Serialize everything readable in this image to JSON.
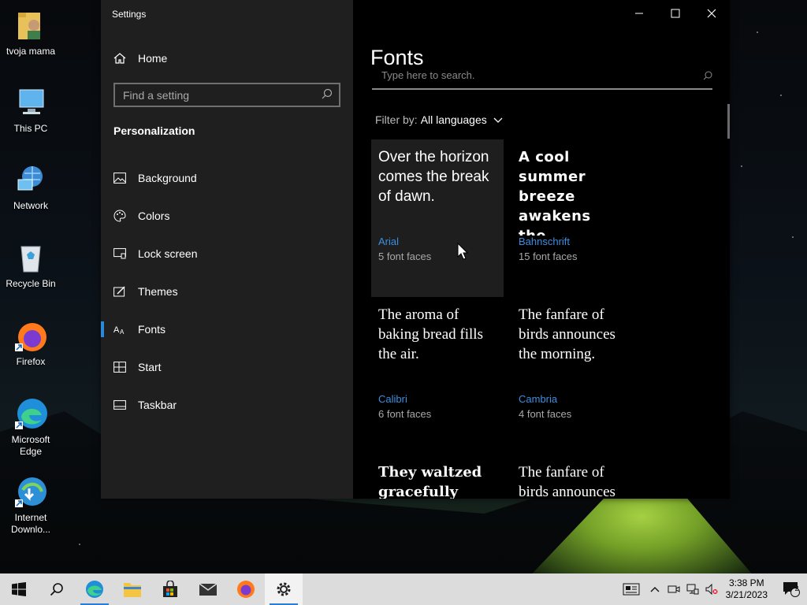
{
  "desktop": {
    "icons": [
      {
        "label": "tvoja mama",
        "icon": "user-folder-icon"
      },
      {
        "label": "This PC",
        "icon": "this-pc-icon"
      },
      {
        "label": "Network",
        "icon": "network-icon"
      },
      {
        "label": "Recycle Bin",
        "icon": "recycle-bin-icon"
      },
      {
        "label": "Firefox",
        "icon": "firefox-icon"
      },
      {
        "label": "Microsoft Edge",
        "icon": "edge-icon"
      },
      {
        "label": "Internet Downlo...",
        "icon": "idm-icon"
      }
    ]
  },
  "window": {
    "title": "Settings"
  },
  "sidebar": {
    "home_label": "Home",
    "search_placeholder": "Find a setting",
    "section_title": "Personalization",
    "items": [
      {
        "label": "Background",
        "icon": "picture-icon"
      },
      {
        "label": "Colors",
        "icon": "palette-icon"
      },
      {
        "label": "Lock screen",
        "icon": "lock-screen-icon"
      },
      {
        "label": "Themes",
        "icon": "themes-icon"
      },
      {
        "label": "Fonts",
        "icon": "fonts-icon",
        "active": true
      },
      {
        "label": "Start",
        "icon": "start-icon"
      },
      {
        "label": "Taskbar",
        "icon": "taskbar-icon"
      }
    ]
  },
  "content": {
    "page_title": "Fonts",
    "search_placeholder": "Type here to search.",
    "filter_label": "Filter by:",
    "filter_value": "All languages",
    "fonts": [
      {
        "sample": "Over the horizon comes the break of dawn.",
        "name": "Arial",
        "faces": "5 font faces"
      },
      {
        "sample": "A cool summer breeze awakens the…",
        "name": "Bahnschrift",
        "faces": "15 font faces"
      },
      {
        "sample": "The aroma of baking bread fills the air.",
        "name": "Calibri",
        "faces": "6 font faces"
      },
      {
        "sample": "The fanfare of birds announces the morning.",
        "name": "Cambria",
        "faces": "4 font faces"
      },
      {
        "sample": "They waltzed gracefully",
        "name": "",
        "faces": ""
      },
      {
        "sample": "The fanfare of birds announces",
        "name": "",
        "faces": ""
      }
    ]
  },
  "taskbar": {
    "items": [
      "start-icon",
      "search-icon",
      "edge-icon",
      "file-explorer-icon",
      "store-icon",
      "mail-icon",
      "firefox-icon",
      "settings-gear-icon"
    ],
    "time": "3:38 PM",
    "date": "3/21/2023",
    "notification_count": "2",
    "colors": {
      "accent": "#2b7cd3",
      "link": "#3b8ee0"
    }
  }
}
